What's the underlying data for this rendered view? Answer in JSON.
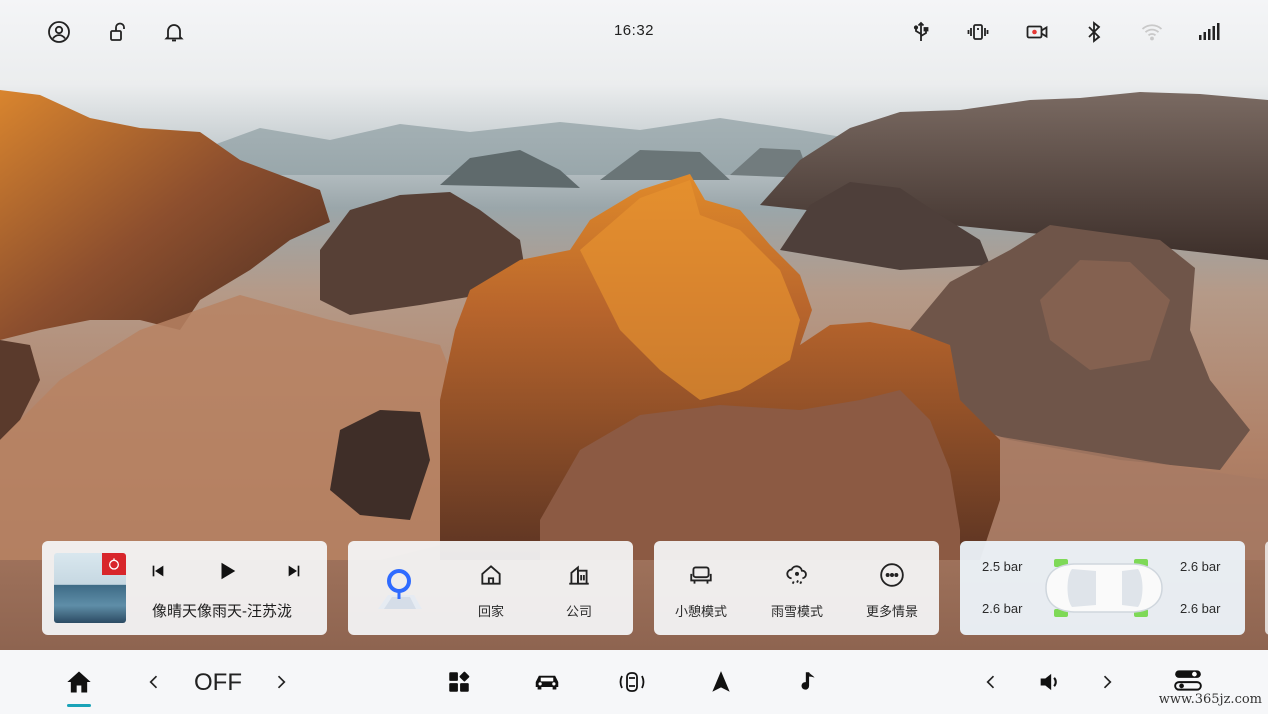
{
  "status_bar": {
    "time": "16:32",
    "left_icons": [
      "user-icon",
      "unlock-icon",
      "bell-icon"
    ],
    "right_icons": [
      "usb-icon",
      "phone-vibrate-icon",
      "camera-record-icon",
      "bluetooth-icon",
      "wifi-icon",
      "signal-icon"
    ]
  },
  "music": {
    "song": "像晴天像雨天-汪苏泷",
    "app_icon": "netease-music-icon",
    "controls": [
      "previous-icon",
      "play-icon",
      "next-icon"
    ]
  },
  "navigation": {
    "search_icon": "map-search-icon",
    "shortcuts": [
      {
        "label": "回家",
        "icon": "home-outline-icon"
      },
      {
        "label": "公司",
        "icon": "office-icon"
      }
    ]
  },
  "modes": {
    "items": [
      {
        "label": "小憩模式",
        "icon": "seat-rest-icon"
      },
      {
        "label": "雨雪模式",
        "icon": "snow-cloud-icon"
      },
      {
        "label": "更多情景",
        "icon": "more-dots-icon"
      }
    ]
  },
  "tire_pressure": {
    "front_left": "2.5 bar",
    "front_right": "2.6 bar",
    "rear_left": "2.6 bar",
    "rear_right": "2.6 bar"
  },
  "dock": {
    "ac_value": "OFF",
    "watermark": "www.365jz.com",
    "icons": [
      "home-icon",
      "chevron-left-icon",
      "chevron-right-icon",
      "apps-icon",
      "car-icon",
      "car-control-icon",
      "navigation-arrow-icon",
      "music-note-icon",
      "volume-down-icon",
      "volume-icon",
      "volume-up-icon",
      "settings-toggle-icon"
    ]
  },
  "colors": {
    "accent": "#1aa3b8",
    "card_bg": "#f5f6f8",
    "tire_green": "#7ed957",
    "music_badge": "#d8262b"
  }
}
